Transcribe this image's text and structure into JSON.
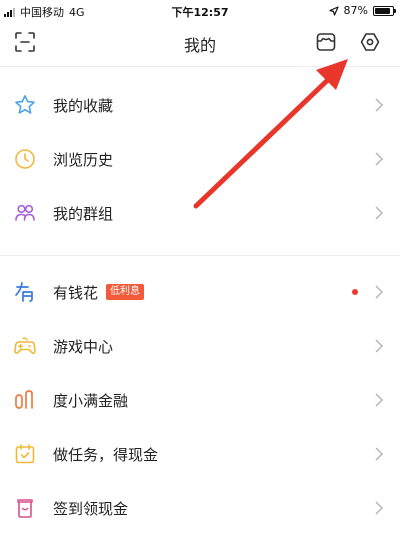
{
  "status_bar": {
    "carrier": "中国移动",
    "network": "4G",
    "time": "下午12:57",
    "battery_percent": "87%",
    "battery_level": 0.87,
    "location_icon": "location-arrow-icon"
  },
  "nav": {
    "title": "我的",
    "left_icon": "scan-icon",
    "right_icons": [
      "wardrobe-icon",
      "settings-icon"
    ]
  },
  "section_1": {
    "items": [
      {
        "label": "我的收藏",
        "icon": "star-icon",
        "icon_color": "#4aa3e8"
      },
      {
        "label": "浏览历史",
        "icon": "clock-icon",
        "icon_color": "#f1b93a"
      },
      {
        "label": "我的群组",
        "icon": "group-icon",
        "icon_color": "#a55fd6"
      }
    ]
  },
  "section_2": {
    "items": [
      {
        "label": "有钱花",
        "icon": "youqianhua-icon",
        "icon_color": "#3a7bdc",
        "badge": "低利息",
        "has_dot": true
      },
      {
        "label": "游戏中心",
        "icon": "gamepad-icon",
        "icon_color": "#f1b93a"
      },
      {
        "label": "度小满金融",
        "icon": "duxiaoman-icon",
        "icon_color": "#f07a3a"
      },
      {
        "label": "做任务，得现金",
        "icon": "calendar-task-icon",
        "icon_color": "#f1b93a"
      },
      {
        "label": "签到领现金",
        "icon": "checkin-icon",
        "icon_color": "#d94f8a"
      }
    ]
  },
  "colors": {
    "badge": "#f15a3b",
    "dot": "#f03a2e",
    "annotation_arrow": "#e8362a",
    "chevron": "#b5b5b5",
    "divider": "#ececec"
  }
}
